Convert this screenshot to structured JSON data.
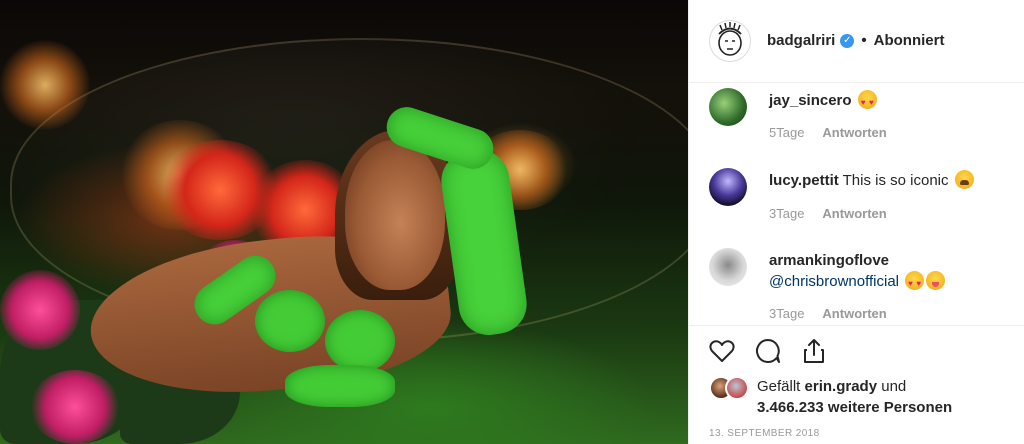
{
  "post": {
    "username": "badgalriri",
    "verified_icon": "verified-badge-icon",
    "separator": "•",
    "follow_status": "Abonniert"
  },
  "comments": [
    {
      "username": "jay_sincero",
      "text": "",
      "mention": "",
      "emoji": [
        "heart-eyes"
      ],
      "age": "5Tage",
      "reply_label": "Antworten"
    },
    {
      "username": "lucy.pettit",
      "text": "This is so iconic",
      "mention": "",
      "emoji": [
        "weary"
      ],
      "age": "3Tage",
      "reply_label": "Antworten"
    },
    {
      "username": "armankingoflove",
      "text": "",
      "mention": "@chrisbrownofficial",
      "emoji": [
        "heart-eyes",
        "yum"
      ],
      "age": "3Tage",
      "reply_label": "Antworten"
    }
  ],
  "likes": {
    "prefix": "Gefällt",
    "liker": "erin.grady",
    "conjunction": "und",
    "others": "3.466.233 weitere Personen"
  },
  "date": "13. SEPTEMBER 2018",
  "icons": [
    "heart-icon",
    "comment-icon",
    "share-icon"
  ],
  "colors": {
    "link": "#003569",
    "verified": "#3897f0",
    "meta": "#999999"
  }
}
